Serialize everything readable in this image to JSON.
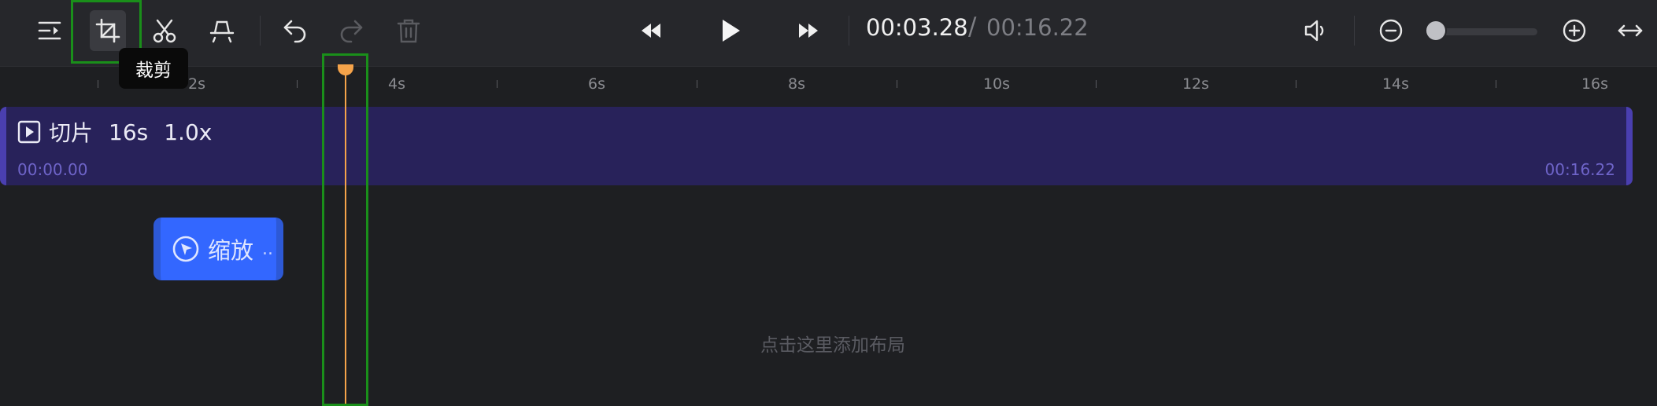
{
  "toolbar": {
    "tooltip": "裁剪",
    "current_time": "00:03.28",
    "separator": "/",
    "total_time": "00:16.22",
    "icons": [
      "menu-icon",
      "crop-icon",
      "scissors-icon",
      "split-icon",
      "undo-icon",
      "redo-icon",
      "delete-icon",
      "rewind-icon",
      "play-icon",
      "fast-forward-icon",
      "volume-icon",
      "zoom-out-icon",
      "zoom-in-icon",
      "fit-width-icon"
    ],
    "zoom_level": 0.05
  },
  "ruler": {
    "labels": [
      "2s",
      "4s",
      "6s",
      "8s",
      "10s",
      "12s",
      "14s",
      "16s"
    ]
  },
  "clip": {
    "title": "切片",
    "duration": "16s",
    "speed": "1.0x",
    "start": "00:00.00",
    "end": "00:16.22"
  },
  "zoom_segment": {
    "label": "缩放",
    "ellipsis": ".."
  },
  "layout_hint": "点击这里添加布局",
  "colors": {
    "accent": "#3367ff",
    "clip": "#28225a",
    "playhead": "#f5a34a",
    "highlight": "#1a8f1a"
  }
}
